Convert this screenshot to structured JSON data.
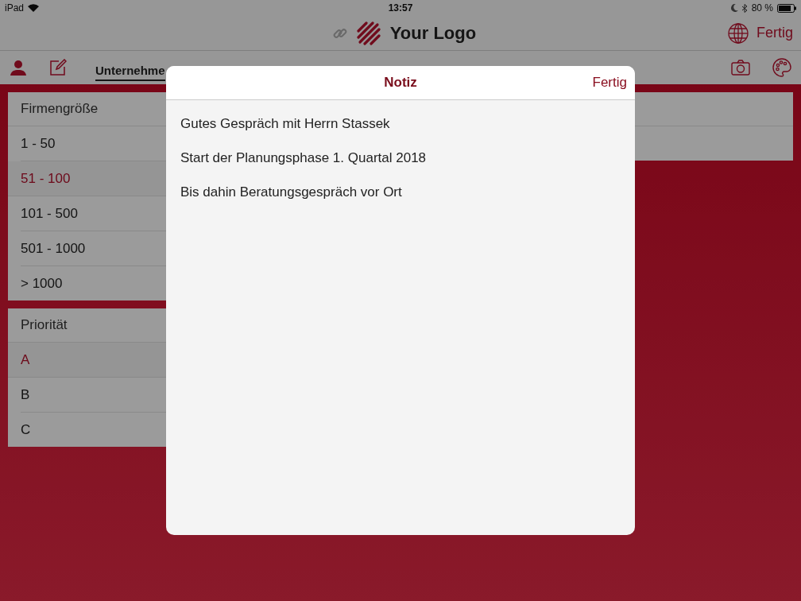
{
  "status_bar": {
    "device": "iPad",
    "time": "13:57",
    "battery": "80 %"
  },
  "header": {
    "logo_text": "Your Logo",
    "done": "Fertig"
  },
  "tabs": [
    {
      "label": "Unternehme",
      "selected": true
    }
  ],
  "groups": [
    {
      "title": "Firmengröße",
      "options": [
        {
          "label": "1 - 50",
          "selected": false
        },
        {
          "label": "51 - 100",
          "selected": true
        },
        {
          "label": "101 - 500",
          "selected": false
        },
        {
          "label": "501 - 1000",
          "selected": false
        },
        {
          "label": "> 1000",
          "selected": false
        }
      ]
    },
    {
      "title": "Priorität",
      "options": [
        {
          "label": "A",
          "selected": true
        },
        {
          "label": "B",
          "selected": false
        },
        {
          "label": "C",
          "selected": false
        }
      ]
    }
  ],
  "modal": {
    "title": "Notiz",
    "done": "Fertig",
    "lines": [
      "Gutes Gespräch mit Herrn Stassek",
      "Start der Planungsphase 1. Quartal 2018",
      "Bis dahin Beratungsgespräch vor Ort"
    ]
  }
}
